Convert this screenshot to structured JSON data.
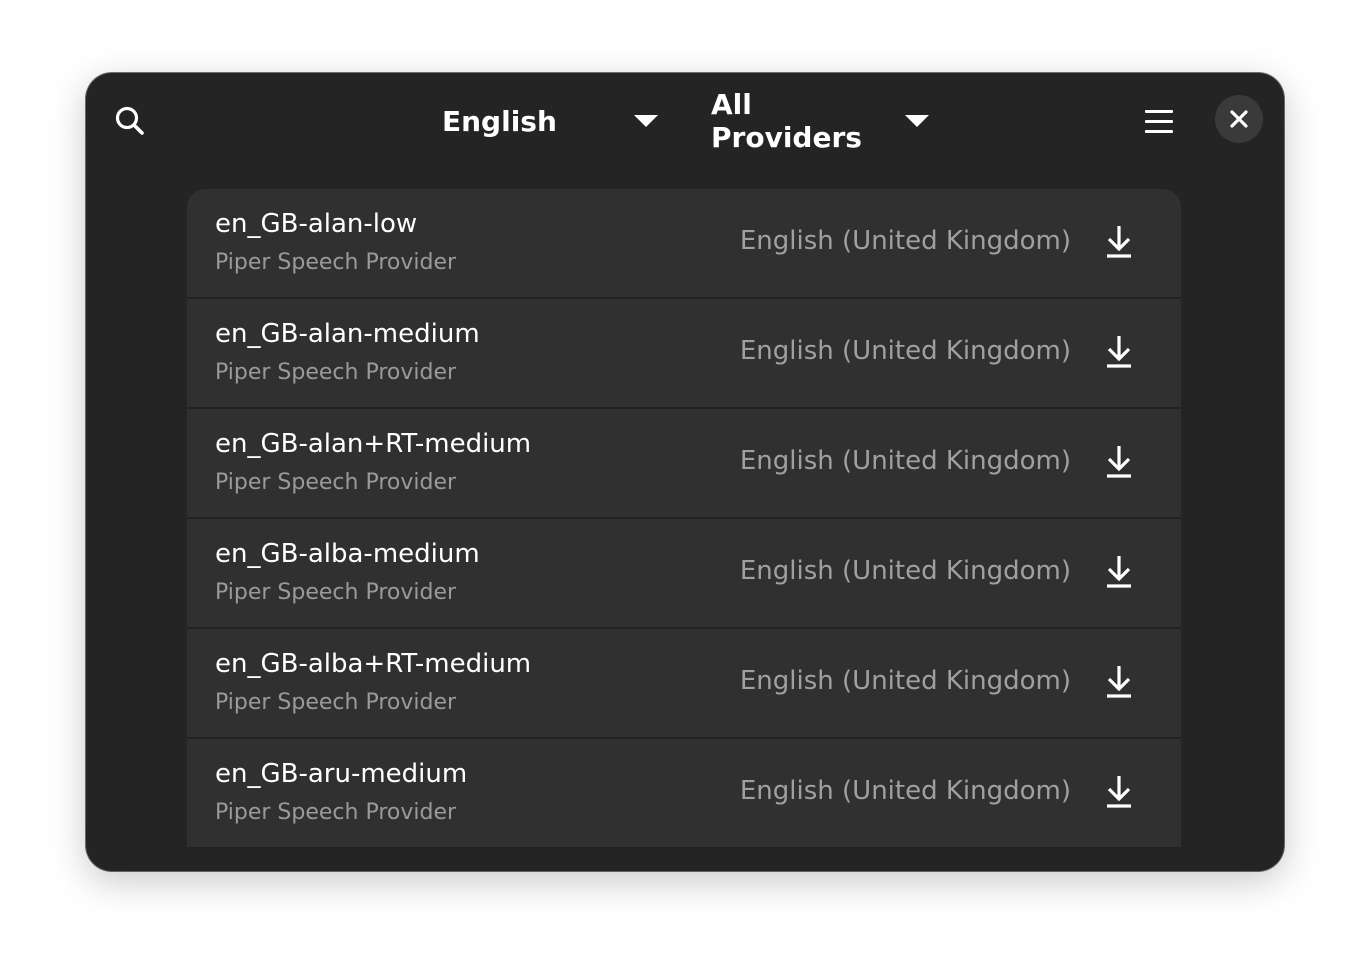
{
  "header": {
    "language_dropdown": {
      "label": "English"
    },
    "provider_dropdown": {
      "label": "All Providers"
    },
    "icons": {
      "search": "search-icon",
      "caret": "chevron-down-icon",
      "menu": "hamburger-menu-icon",
      "close": "close-icon"
    }
  },
  "voices": [
    {
      "name": "en_GB-alan-low",
      "provider": "Piper Speech Provider",
      "language": "English (United Kingdom)",
      "action_icon": "download-icon"
    },
    {
      "name": "en_GB-alan-medium",
      "provider": "Piper Speech Provider",
      "language": "English (United Kingdom)",
      "action_icon": "download-icon"
    },
    {
      "name": "en_GB-alan+RT-medium",
      "provider": "Piper Speech Provider",
      "language": "English (United Kingdom)",
      "action_icon": "download-icon"
    },
    {
      "name": "en_GB-alba-medium",
      "provider": "Piper Speech Provider",
      "language": "English (United Kingdom)",
      "action_icon": "download-icon"
    },
    {
      "name": "en_GB-alba+RT-medium",
      "provider": "Piper Speech Provider",
      "language": "English (United Kingdom)",
      "action_icon": "download-icon"
    },
    {
      "name": "en_GB-aru-medium",
      "provider": "Piper Speech Provider",
      "language": "English (United Kingdom)",
      "action_icon": "download-icon"
    }
  ],
  "colors": {
    "window_bg": "#242424",
    "row_bg": "#303030",
    "primary_text": "#ffffff",
    "secondary_text": "#9a9a9a"
  }
}
